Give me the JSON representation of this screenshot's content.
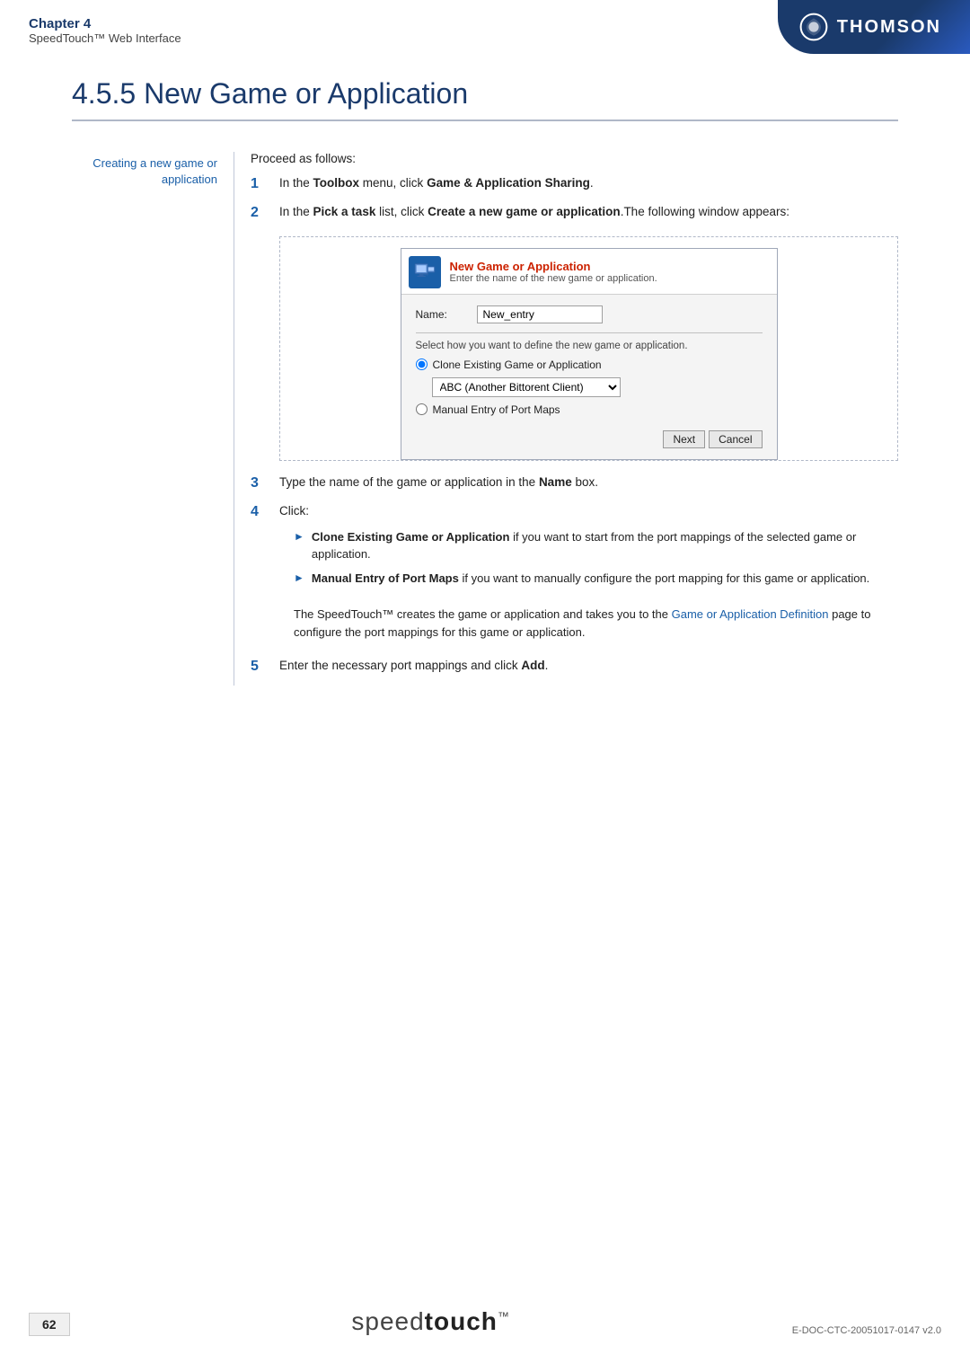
{
  "header": {
    "chapter_title": "Chapter 4",
    "chapter_subtitle": "SpeedTouch™ Web Interface",
    "thomson_label": "THOMSON"
  },
  "page_title": "4.5.5  New Game or Application",
  "sidebar": {
    "heading_line1": "Creating a new game or",
    "heading_line2": "application"
  },
  "proceed_text": "Proceed as follows:",
  "steps": [
    {
      "number": "1",
      "text_parts": [
        {
          "text": "In the ",
          "bold": false
        },
        {
          "text": "Toolbox",
          "bold": true
        },
        {
          "text": " menu, click ",
          "bold": false
        },
        {
          "text": "Game & Application Sharing",
          "bold": true
        },
        {
          "text": ".",
          "bold": false
        }
      ]
    },
    {
      "number": "2",
      "text_parts": [
        {
          "text": "In the ",
          "bold": false
        },
        {
          "text": "Pick a task",
          "bold": true
        },
        {
          "text": " list, click ",
          "bold": false
        },
        {
          "text": "Create a new game or application",
          "bold": true
        },
        {
          "text": ".The following window appears:",
          "bold": false
        }
      ]
    },
    {
      "number": "3",
      "text_parts": [
        {
          "text": "Type the name of the game or application in the ",
          "bold": false
        },
        {
          "text": "Name",
          "bold": true
        },
        {
          "text": " box.",
          "bold": false
        }
      ]
    },
    {
      "number": "4",
      "text_parts": [
        {
          "text": "Click:",
          "bold": false
        }
      ]
    },
    {
      "number": "5",
      "text_parts": [
        {
          "text": "Enter the necessary port mappings and click ",
          "bold": false
        },
        {
          "text": "Add",
          "bold": true
        },
        {
          "text": ".",
          "bold": false
        }
      ]
    }
  ],
  "dialog": {
    "title_main": "New Game or Application",
    "title_sub": "Enter the name of the new game or application.",
    "name_label": "Name:",
    "name_value": "New_entry",
    "select_label": "Select how you want to define the new game or application.",
    "radio1_label": "Clone Existing Game or Application",
    "radio1_checked": true,
    "dropdown_value": "ABC (Another Bittorent Client)",
    "radio2_label": "Manual Entry of Port Maps",
    "radio2_checked": false,
    "next_btn": "Next",
    "cancel_btn": "Cancel"
  },
  "sub_steps": [
    {
      "text_parts": [
        {
          "text": "Clone Existing Game or Application",
          "bold": true
        },
        {
          "text": " if you want to start from the port mappings of the selected game or application.",
          "bold": false
        }
      ]
    },
    {
      "text_parts": [
        {
          "text": "Manual Entry of Port Maps",
          "bold": true
        },
        {
          "text": " if you want to manually configure the port mapping for this game or application.",
          "bold": false
        }
      ]
    }
  ],
  "note_text_before_link": "The SpeedTouch™ creates the game or application and takes you to the ",
  "note_link_text": "Game or Application Definition",
  "note_text_after_link": " page to configure the port mappings for this game or application.",
  "footer": {
    "page_number": "62",
    "brand_regular": "speed",
    "brand_bold": "touch",
    "brand_super": "™",
    "doc_number": "E-DOC-CTC-20051017-0147 v2.0"
  }
}
